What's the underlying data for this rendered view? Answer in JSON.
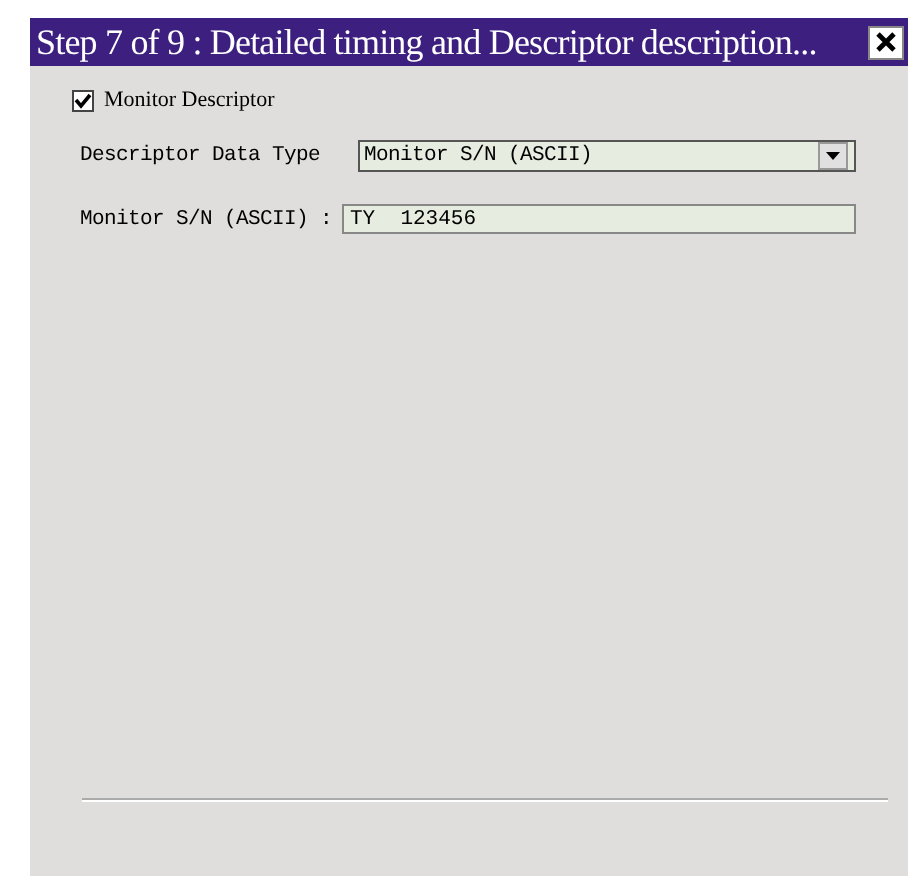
{
  "window": {
    "title": "Step 7 of 9 : Detailed timing and Descriptor description..."
  },
  "monitor_descriptor": {
    "label": "Monitor Descriptor",
    "checked": true
  },
  "descriptor_data_type": {
    "label": "Descriptor Data Type",
    "value": "Monitor S/N (ASCII)"
  },
  "monitor_sn": {
    "label": "Monitor S/N (ASCII) :",
    "value": "TY  123456"
  }
}
